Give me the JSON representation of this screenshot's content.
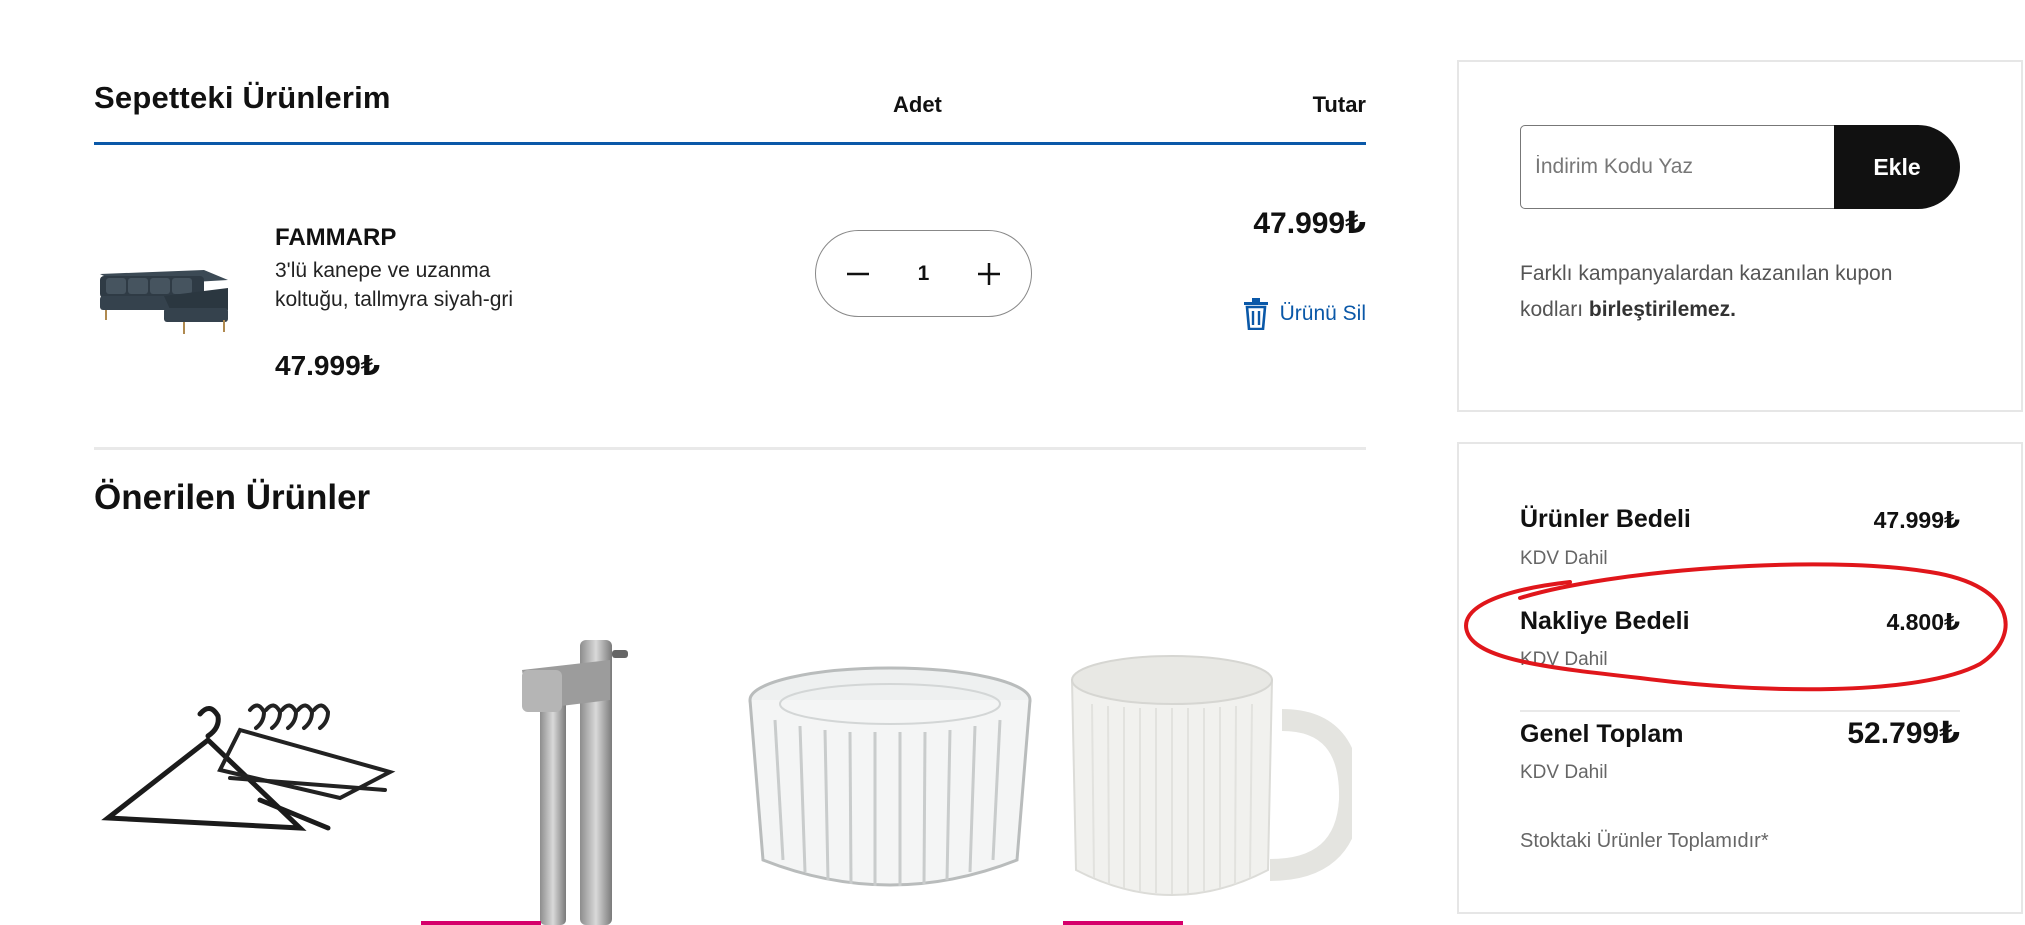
{
  "cart": {
    "title": "Sepetteki Ürünlerim",
    "col_qty": "Adet",
    "col_total": "Tutar",
    "item": {
      "name": "FAMMARP",
      "description": "3'lü kanepe ve uzanma koltuğu, tallmyra siyah-gri",
      "price": "47.999₺",
      "quantity": "1",
      "line_total": "47.999₺",
      "remove_label": "Ürünü Sil"
    }
  },
  "recommended": {
    "title": "Önerilen Ürünler",
    "items": [
      {
        "icon": "hangers-image"
      },
      {
        "icon": "garlic-press-image"
      },
      {
        "icon": "glass-tealight-holder-image"
      },
      {
        "icon": "ribbed-mug-image"
      }
    ]
  },
  "coupon": {
    "placeholder": "İndirim Kodu Yaz",
    "button_label": "Ekle",
    "note_prefix": "Farklı kampanyalardan kazanılan kupon kodları ",
    "note_bold": "birleştirilemez."
  },
  "summary": {
    "products_label": "Ürünler Bedeli",
    "products_value": "47.999₺",
    "products_sub": "KDV Dahil",
    "shipping_label": "Nakliye Bedeli",
    "shipping_value": "4.800₺",
    "shipping_sub": "KDV Dahil",
    "total_label": "Genel Toplam",
    "total_value": "52.799₺",
    "total_sub": "KDV Dahil",
    "stock_note": "Stoktaki Ürünler Toplamıdır*"
  },
  "colors": {
    "accent_blue": "#0a58a8",
    "button_black": "#111111",
    "highlight_red": "#e0161b",
    "promo_pink": "#d6006b"
  }
}
